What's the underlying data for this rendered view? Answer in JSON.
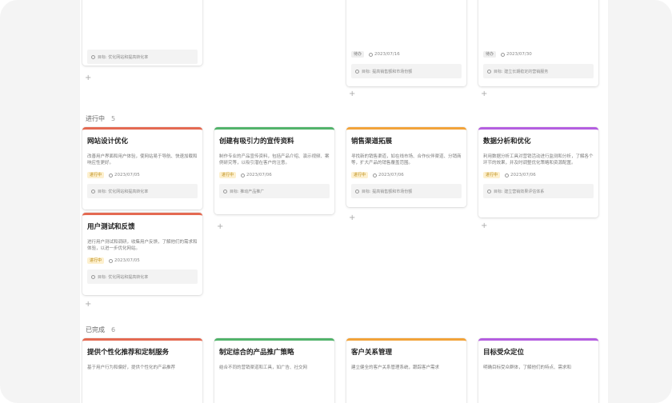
{
  "groups": {
    "in_progress": {
      "label": "进行中",
      "count": "5"
    },
    "done": {
      "label": "已完成",
      "count": "6"
    }
  },
  "top_cards": [
    {
      "goal": "目标: 优化网站和提高转化率"
    },
    {
      "tag": "待办",
      "date": "2023/07/16",
      "goal": "目标: 提高销售额和市场份额"
    },
    {
      "tag": "待办",
      "date": "2023/07/30",
      "goal": "目标: 建立长期稳定的营销服务"
    }
  ],
  "in_progress_cards": [
    {
      "title": "网站设计优化",
      "desc": "改善用户界面和用户体验，使网站易于导航、快速加载和响应性更好。",
      "tag": "进行中",
      "date": "2023/07/05",
      "goal": "目标: 优化网站和提高转化率"
    },
    {
      "title": "用户测试和反馈",
      "desc": "进行用户测试和调研，收集用户反馈，了解他们的需求和体验，以进一步优化网站。",
      "tag": "进行中",
      "date": "2023/07/05",
      "goal": "目标: 优化网站和提高转化率"
    },
    {
      "title": "创建有吸引力的宣传资料",
      "desc": "制作专业的产品宣传资料，包括产品介绍、演示视频、案例研究等，以吸引潜在客户的注意。",
      "tag": "进行中",
      "date": "2023/07/06",
      "goal": "目标: 推动产品推广"
    },
    {
      "title": "销售渠道拓展",
      "desc": "寻找新的销售渠道，如在线市场、合作伙伴渠道、分销商等，扩大产品的销售覆盖范围。",
      "tag": "进行中",
      "date": "2023/07/06",
      "goal": "目标: 提高销售额和市场份额"
    },
    {
      "title": "数据分析和优化",
      "desc": "利用数据分析工具对营销活动进行监测和分析，了解各个环节的效果，并及时调整优化策略和资源配置。",
      "tag": "进行中",
      "date": "2023/07/06",
      "goal": "目标: 建立营销效果评估体系"
    }
  ],
  "done_cards": [
    {
      "title": "提供个性化推荐和定制服务",
      "desc": "基于用户行为和偏好，提供个性化的产品推荐"
    },
    {
      "title": "制定综合的产品推广策略",
      "desc": "结合不同的营销渠道和工具，如广告、社交网"
    },
    {
      "title": "客户关系管理",
      "desc": "建立健全的客户关系管理系统，跟踪客户需求"
    },
    {
      "title": "目标受众定位",
      "desc": "明确目标受众群体，了解他们的特点、需求和"
    }
  ],
  "colors": {
    "red": "#e46a52",
    "green": "#52b36b",
    "orange": "#f2a33a",
    "purple": "#b45ee0",
    "tag_progress": "#fdf0cf"
  },
  "icons": {
    "date": "clock-icon",
    "goal": "target-icon",
    "add": "plus-icon"
  }
}
